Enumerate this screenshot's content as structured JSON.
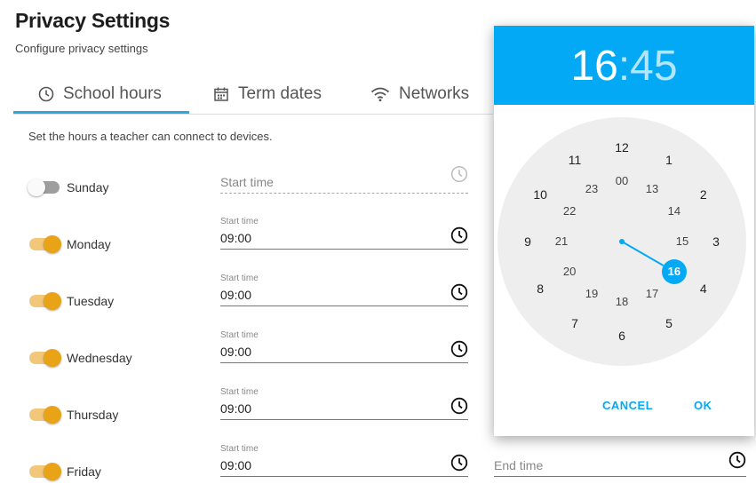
{
  "page": {
    "title": "Privacy Settings",
    "subtitle": "Configure privacy settings"
  },
  "tabs": [
    {
      "label": "School hours",
      "icon": "clock-icon",
      "active": true
    },
    {
      "label": "Term dates",
      "icon": "calendar-icon",
      "active": false
    },
    {
      "label": "Networks",
      "icon": "wifi-icon",
      "active": false
    }
  ],
  "description": "Set the hours a teacher can connect to devices.",
  "days": [
    {
      "name": "Sunday",
      "enabled": false,
      "start_label": "",
      "start_value": "",
      "placeholder": "Start time"
    },
    {
      "name": "Monday",
      "enabled": true,
      "start_label": "Start time",
      "start_value": "09:00"
    },
    {
      "name": "Tuesday",
      "enabled": true,
      "start_label": "Start time",
      "start_value": "09:00"
    },
    {
      "name": "Wednesday",
      "enabled": true,
      "start_label": "Start time",
      "start_value": "09:00"
    },
    {
      "name": "Thursday",
      "enabled": true,
      "start_label": "Start time",
      "start_value": "09:00"
    },
    {
      "name": "Friday",
      "enabled": true,
      "start_label": "Start time",
      "start_value": "09:00"
    }
  ],
  "end_field": {
    "placeholder": "End time"
  },
  "time_picker": {
    "hours": "16",
    "separator": ":",
    "minutes": "45",
    "selected_hour": "16",
    "outer_numbers": [
      "12",
      "1",
      "2",
      "3",
      "4",
      "5",
      "6",
      "7",
      "8",
      "9",
      "10",
      "11"
    ],
    "inner_numbers": [
      "00",
      "13",
      "14",
      "15",
      "16",
      "17",
      "18",
      "19",
      "20",
      "21",
      "22",
      "23"
    ],
    "cancel_label": "CANCEL",
    "ok_label": "OK"
  },
  "colors": {
    "accent": "#03a9f4",
    "tab_indicator": "#2aa8e0",
    "toggle_on": "#e8a317",
    "toggle_track_on": "#f3c77a"
  }
}
